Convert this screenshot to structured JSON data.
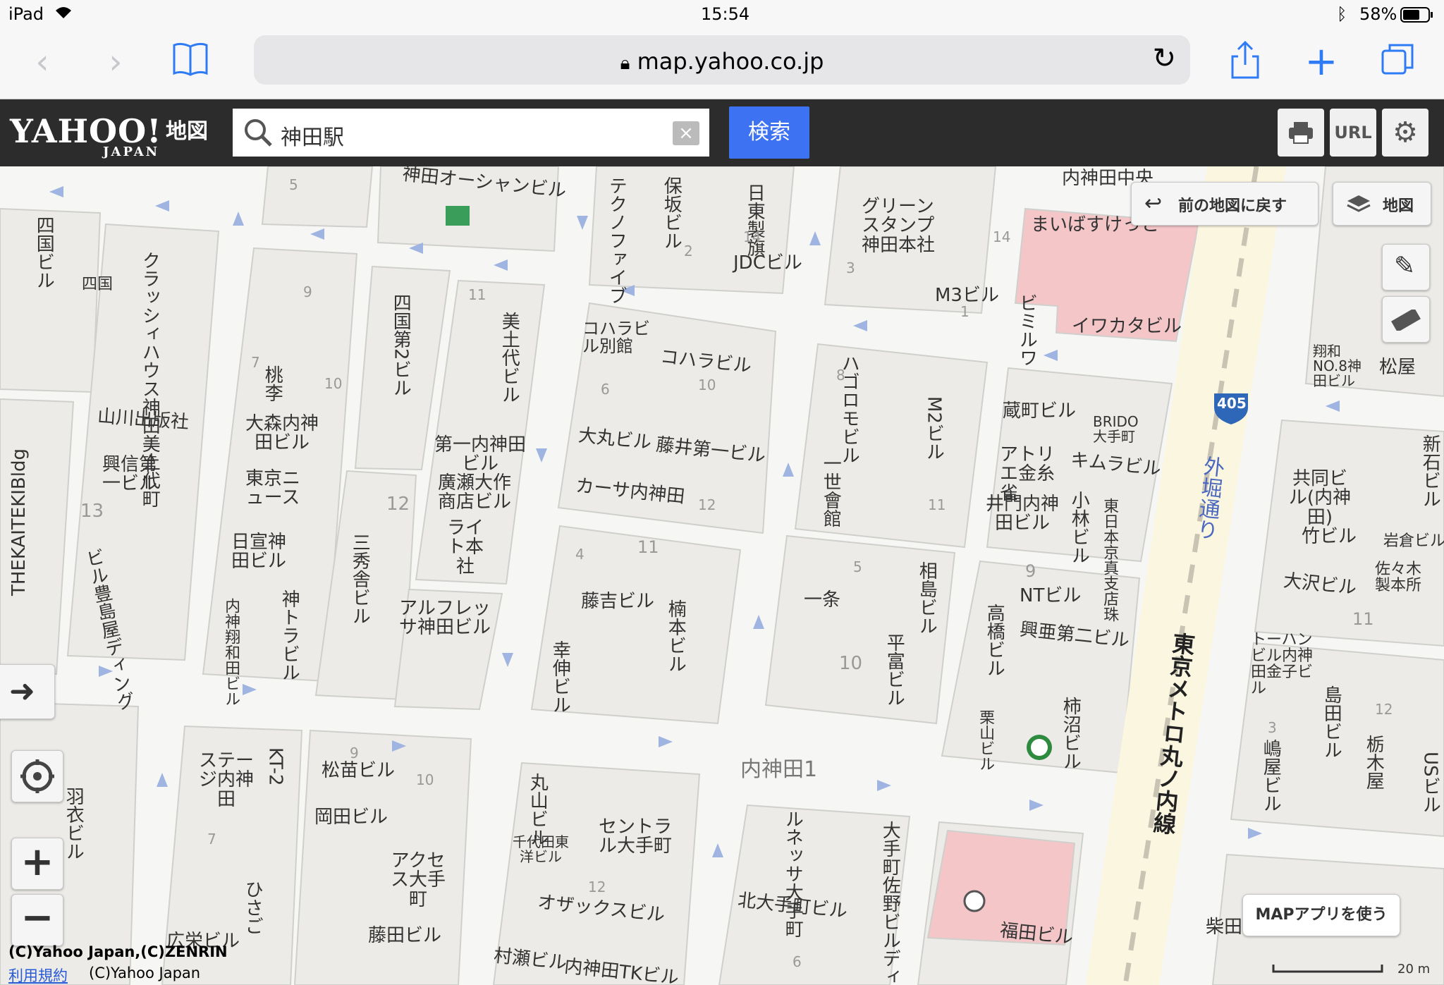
{
  "status": {
    "device": "iPad",
    "time": "15:54",
    "battery": "58%"
  },
  "browser": {
    "url": "map.yahoo.co.jp"
  },
  "header": {
    "logo_main": "YAHOO!",
    "logo_sub": "JAPAN",
    "logo_suffix": "地図",
    "search_value": "神田駅",
    "clear_label": "×",
    "search_button": "検索",
    "url_button": "URL"
  },
  "map_controls": {
    "back_label": "前の地図に戻す",
    "layer_label": "地図",
    "app_button": "MAPアプリを使う",
    "scale_label": "20 m",
    "zoom_in": "+",
    "zoom_out": "−"
  },
  "copyright": {
    "line1": "(C)Yahoo Japan,(C)ZENRIN",
    "terms": "利用規約",
    "line2": "(C)Yahoo Japan"
  },
  "map_labels": {
    "area": "内神田1",
    "rail": "東京メトロ丸ノ内線",
    "road": "外堀通り",
    "route": "405",
    "b01": "神田オーシャンビル",
    "b02": "保坂ビル",
    "b03": "日東製旗",
    "b04": "JDCビル",
    "b05": "テクノファイブ",
    "b06": "グリーンスタンプ神田本社",
    "b07": "M3ビル",
    "b08": "まいばすけっと",
    "b09": "イワカタビル",
    "b10": "ビミルワ",
    "b11": "四国ビル",
    "b12": "四国",
    "b13": "クラッシィハウス神田美土代町",
    "b14": "四国第2ビル",
    "b15": "美土代ビル",
    "b16": "コハラビル別館",
    "b17": "コハラビル",
    "b18": "ハゴロモビル",
    "b19": "M2ビル",
    "b20": "蔵町ビル",
    "b21": "BRIDO大手町",
    "b22": "翔和NO.8神田ビル",
    "b23": "松屋",
    "b24": "山川出版社",
    "b25": "桃李",
    "b26": "大森内神田ビル",
    "b27": "第一内神田ビル",
    "b28": "大丸ビル",
    "b29": "藤井第一ビル",
    "b30": "アトリエ金糸雀",
    "b31": "キムラビル",
    "b32": "THEKAITEKIBldg",
    "b33": "興信第一ビル",
    "b34": "東京ニュース",
    "b35": "廣瀬大作商店ビル",
    "b36": "カーサ内神田",
    "b37": "一世會館",
    "b38": "井門内神田ビル",
    "b39": "小林ビル",
    "b40": "東日本京真支店珠",
    "b41": "共同ビル(内神田)",
    "b42": "竹ビル",
    "b43": "岩倉ビル",
    "b44": "ビル豊島屋ディング",
    "b45": "日宣神田ビル",
    "b46": "三秀舎ビル",
    "b47": "ライト本社",
    "b48": "藤吉ビル",
    "b49": "楠本ビル",
    "b50": "一条",
    "b51": "相島ビル",
    "b52": "NTビル",
    "b53": "大沢ビル",
    "b54": "佐々木製本所",
    "b55": "内神翔和田ビル",
    "b56": "神トラビル",
    "b57": "アルフレッサ神田ビル",
    "b58": "幸伸ビル",
    "b59": "平富ビル",
    "b60": "高橋ビル",
    "b61": "興亜第二ビル",
    "b62": "トーハンビル内神田金子ビル",
    "b63": "島田ビル",
    "b64": "栃木屋",
    "b65": "柿沼ビル",
    "b66": "栗山ビル",
    "b67": "嶋屋ビル",
    "b68": "ステージ内神田",
    "b69": "KT-2",
    "b70": "羽衣ビル",
    "b71": "松苗ビル",
    "b72": "岡田ビル",
    "b73": "丸山ビル",
    "b74": "千代田東洋ビル",
    "b75": "セントラル大手町",
    "b76": "ルネッサ大手町",
    "b77": "大手町佐野ビルディング",
    "b78": "アクセス大手町",
    "b79": "ひさご",
    "b80": "オザックスビル",
    "b81": "北大手町ビル",
    "b82": "福田ビル",
    "b83": "藤田ビル",
    "b84": "広栄ビル",
    "b85": "村瀬ビル",
    "b86": "内神田TKビル",
    "b87": "柴田ビル",
    "b88": "新石ビル",
    "b89": "USビル",
    "b90": "内神田中央"
  },
  "block_numbers": [
    "5",
    "9",
    "7",
    "10",
    "11",
    "12",
    "13",
    "6",
    "8",
    "4",
    "2",
    "3",
    "14",
    "1"
  ]
}
